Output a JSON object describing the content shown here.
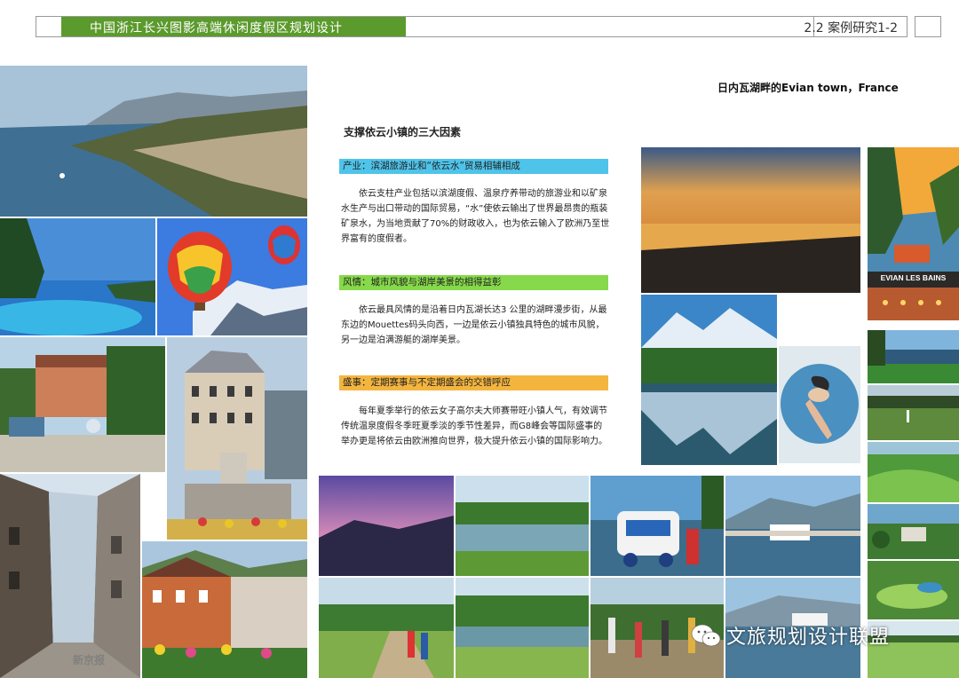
{
  "header": {
    "title": "中国浙江长兴图影高端休闲度假区规划设计",
    "section": "2.2  案例研究1-2"
  },
  "location": "日内瓦湖畔的Evian town，France",
  "article": {
    "title": "支撑依云小镇的三大因素",
    "sections": [
      {
        "tag": "产业：滨湖旅游业和“依云水”贸易相辅相成",
        "text": "依云支柱产业包括以滨湖度假、温泉疗养带动的旅游业和以矿泉水生产与出口带动的国际贸易，“水”使依云输出了世界最昂贵的瓶装矿泉水，为当地贡献了70%的财政收入，也为依云输入了欧洲乃至世界富有的度假者。"
      },
      {
        "tag": "风情：城市风貌与湖岸美景的相得益彰",
        "text": "依云最具风情的是沿着日内瓦湖长达3 公里的湖畔漫步街，从最东边的Mouettes码头向西，一边是依云小镇独具特色的城市风貌，另一边是泊满游艇的湖岸美景。"
      },
      {
        "tag": "盛事：定期赛事与不定期盛会的交错呼应",
        "text": "每年夏季举行的依云女子高尔夫大师赛带旺小镇人气，有效调节传统温泉度假冬季旺夏季淡的季节性差异，而G8峰会等国际盛事的举办更是将依云由欧洲推向世界，极大提升依云小镇的国际影响力。"
      }
    ]
  },
  "poster": {
    "caption": "EVIAN LES BAINS"
  },
  "watermark": {
    "text": "文旅规划设计联盟",
    "icon": "wechat-icon"
  },
  "stamp": "新京报"
}
